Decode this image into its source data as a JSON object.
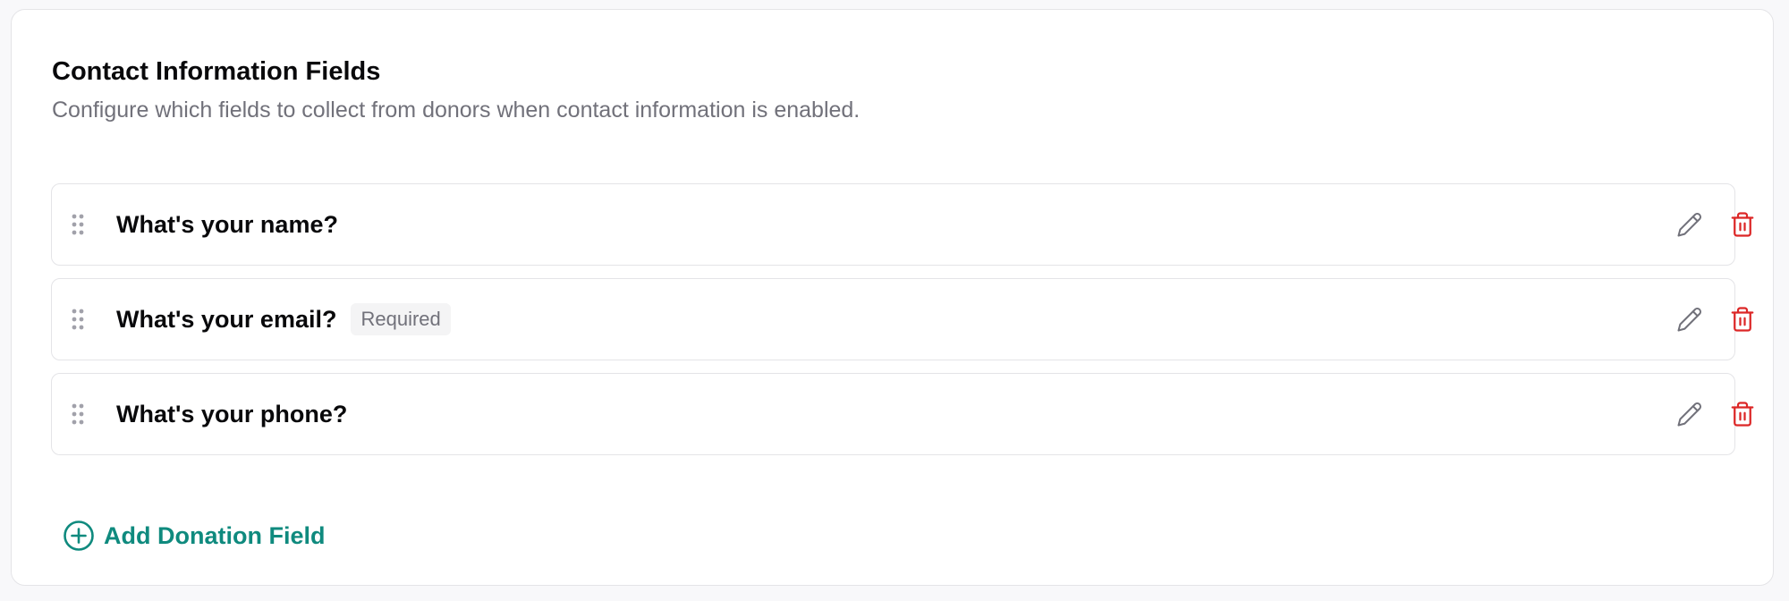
{
  "section": {
    "title": "Contact Information Fields",
    "subtitle": "Configure which fields to collect from donors when contact information is enabled."
  },
  "fields": [
    {
      "label": "What's your name?",
      "badge": ""
    },
    {
      "label": "What's your email?",
      "badge": "Required"
    },
    {
      "label": "What's your phone?",
      "badge": ""
    }
  ],
  "actions": {
    "add_field_label": "Add Donation Field"
  },
  "icons": {
    "drag": "grip-vertical-icon",
    "edit": "pencil-icon",
    "delete": "trash-icon",
    "add": "plus-circle-icon"
  },
  "colors": {
    "accent": "#0f8a7e",
    "danger": "#dc2626",
    "muted_text": "#71717a",
    "border": "#e4e4e7"
  }
}
